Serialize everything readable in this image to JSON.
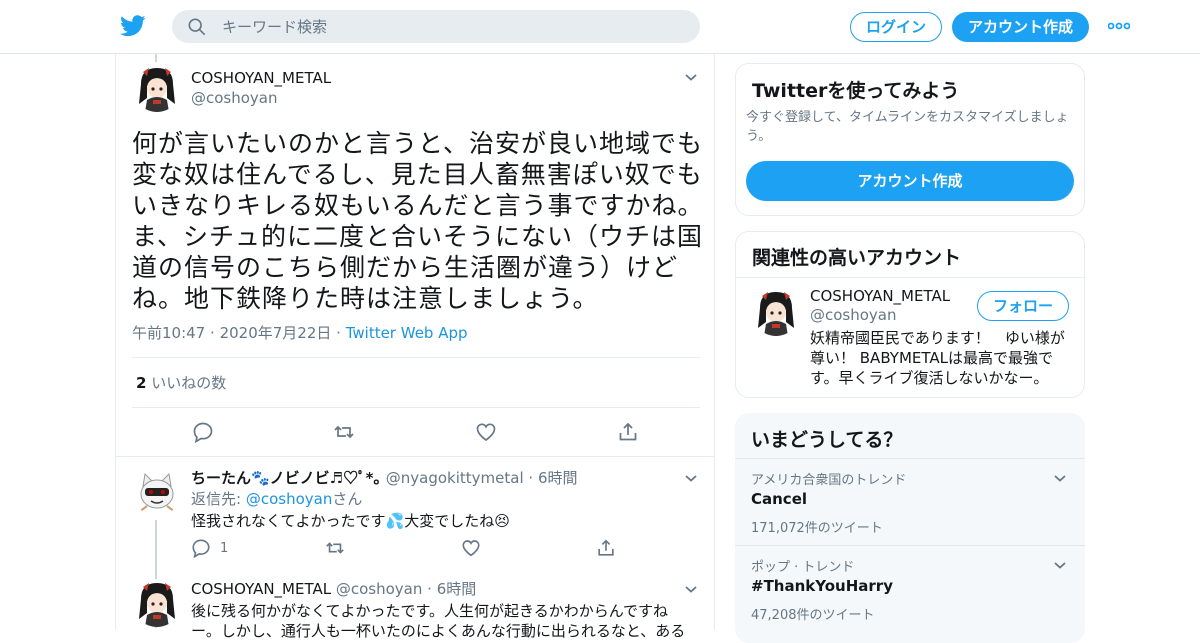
{
  "colors": {
    "accent": "#1da1f2",
    "link": "#1b95e0",
    "muted": "#657786",
    "border": "#e6ecf0"
  },
  "header": {
    "logo_icon": "twitter-bird-icon",
    "search_placeholder": "キーワード検索",
    "login_label": "ログイン",
    "signup_label": "アカウント作成"
  },
  "main_tweet": {
    "name": "COSHOYAN_METAL",
    "handle": "@coshoyan",
    "text": "何が言いたいのかと言うと、治安が良い地域でも変な奴は住んでるし、見た目人畜無害ぽい奴でもいきなりキレる奴もいるんだと言う事ですかね。ま、シチュ的に二度と合いそうにない（ウチは国道の信号のこちら側だから生活圏が違う）けどね。地下鉄降りた時は注意しましょう。",
    "time": "午前10:47",
    "date": "2020年7月22日",
    "source": "Twitter Web App",
    "likes_count": "2",
    "likes_label": "いいねの数"
  },
  "replies": [
    {
      "name": "ちーたん🐾ノビノビ♬♡ﾟ*｡",
      "handle": "@nyagokittymetal",
      "time": "6時間",
      "reply_prefix": "返信先: ",
      "reply_handle": "@coshoyan",
      "reply_suffix": "さん",
      "text": "怪我されなくてよかったです💦大変でしたね😣",
      "reply_count": "1"
    },
    {
      "name": "COSHOYAN_METAL",
      "handle": "@coshoyan",
      "time": "6時間",
      "text_line1": "後に残る何かがなくてよかったです。人生何が起きるかわからんですね",
      "text_line2": "ー。しかし、通行人も一杯いたのによくあんな行動に出られるなと、ある"
    }
  ],
  "sidebar": {
    "signup_card": {
      "title": "Twitterを使ってみよう",
      "subtitle": "今すぐ登録して、タイムラインをカスタマイズしましょう。",
      "button": "アカウント作成"
    },
    "related_card": {
      "title": "関連性の高いアカウント",
      "name": "COSHOYAN_METAL",
      "handle": "@coshoyan",
      "follow_label": "フォロー",
      "bio": "妖精帝國臣民であります！　ゆい様が尊い！ BABYMETALは最高で最強です。早くライブ復活しないかなー。"
    },
    "trends_card": {
      "title": "いまどうしてる？",
      "items": [
        {
          "category": "アメリカ合衆国のトレンド",
          "name": "Cancel",
          "count": "171,072件のツイート"
        },
        {
          "category": "ポップ · トレンド",
          "name": "#ThankYouHarry",
          "count": "47,208件のツイート"
        }
      ]
    }
  }
}
